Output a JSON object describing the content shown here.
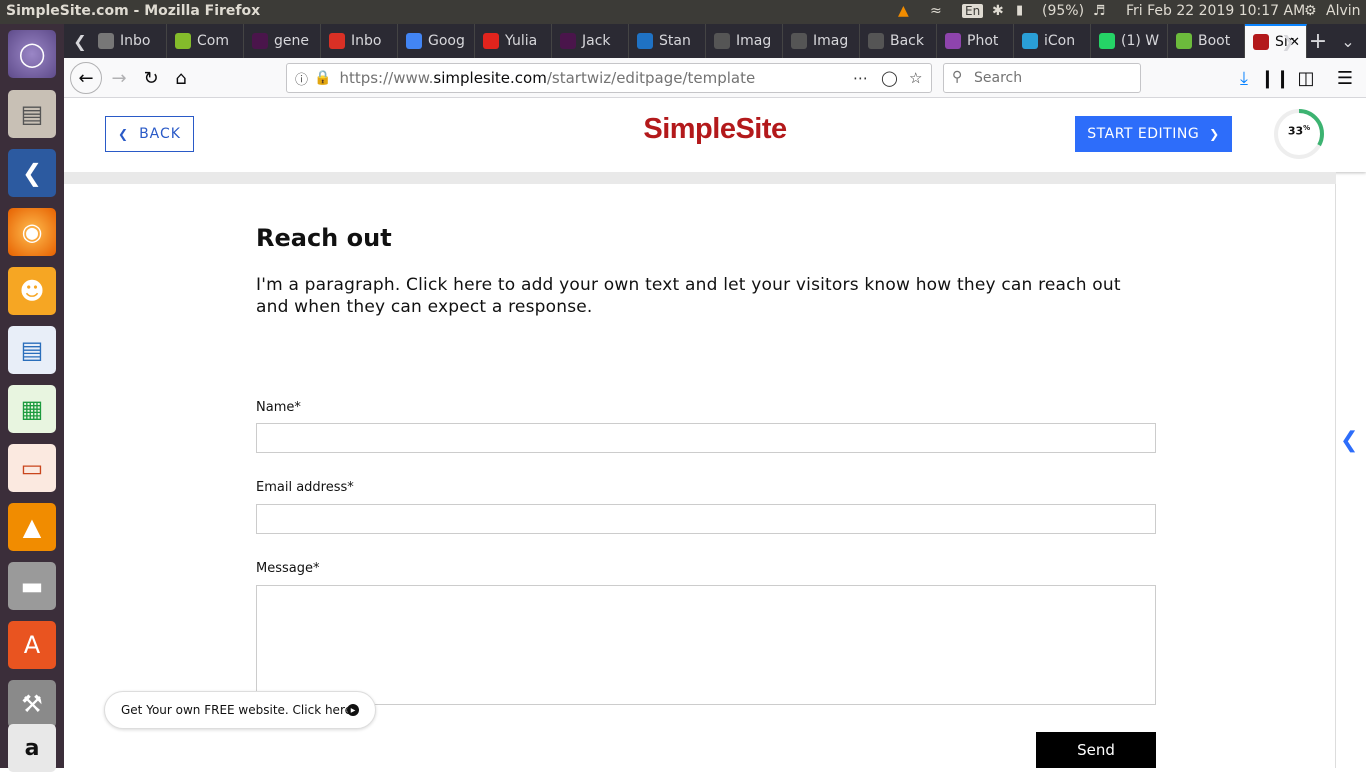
{
  "topbar": {
    "window_title": "SimpleSite.com - Mozilla Firefox",
    "keyboard": "En",
    "battery": "(95%)",
    "datetime": "Fri Feb 22 2019 10:17 AM",
    "user": "Alvin"
  },
  "tabs": [
    {
      "label": "Inbo",
      "color": "#777777"
    },
    {
      "label": "Com",
      "color": "#84bc2b"
    },
    {
      "label": "gene",
      "color": "#4a154b"
    },
    {
      "label": "Inbo",
      "color": "#d93025"
    },
    {
      "label": "Goog",
      "color": "#4285f4"
    },
    {
      "label": "Yulia",
      "color": "#e1241d"
    },
    {
      "label": "Jack",
      "color": "#4a154b"
    },
    {
      "label": "Stan",
      "color": "#1f72c4"
    },
    {
      "label": "Imag",
      "color": "#555555"
    },
    {
      "label": "Imag",
      "color": "#555555"
    },
    {
      "label": "Back",
      "color": "#555555"
    },
    {
      "label": "Phot",
      "color": "#8e44ad"
    },
    {
      "label": "iCon",
      "color": "#2a9fd6"
    },
    {
      "label": "(1) W",
      "color": "#25d366"
    },
    {
      "label": "Boot",
      "color": "#6cbb3c"
    },
    {
      "label": "Sir",
      "color": "#b3191b"
    }
  ],
  "navbar": {
    "url_prefix": "https://www.",
    "url_domain": "simplesite.com",
    "url_path": "/startwiz/editpage/template",
    "search_placeholder": "Search"
  },
  "site_header": {
    "back_label": "BACK",
    "logo": "SimpleSite",
    "start_label": "START EDITING",
    "progress_label": "33",
    "progress_unit": "%",
    "progress_value": 0.33
  },
  "content": {
    "heading": "Reach out",
    "paragraph": "I'm a paragraph. Click here to add your own text and let your visitors know how they can reach out and when they can expect a response.",
    "name_label": "Name*",
    "email_label": "Email address*",
    "message_label": "Message*",
    "send_label": "Send",
    "promo_text": "Get Your own FREE website. Click here!"
  },
  "colors": {
    "brand_red": "#b3191b",
    "accent_blue": "#2d6dfa",
    "launcher_bg": "#3b2e3a"
  }
}
